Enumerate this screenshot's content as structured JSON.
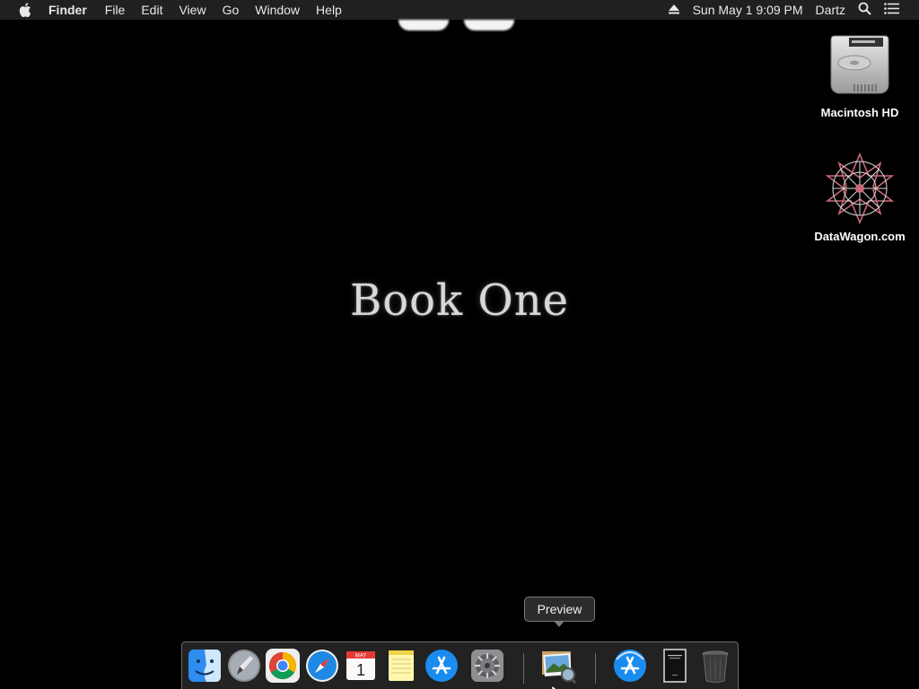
{
  "menubar": {
    "apple_icon": "apple-icon",
    "app_name": "Finder",
    "menus": [
      "File",
      "Edit",
      "View",
      "Go",
      "Window",
      "Help"
    ],
    "eject_icon": "eject-icon",
    "clock": "Sun May 1  9:09 PM",
    "user": "Dartz",
    "search_icon": "spotlight-search-icon",
    "notifications_icon": "notification-center-icon"
  },
  "wallpaper": {
    "title": "Book One"
  },
  "desktop_icons": [
    {
      "label": "Macintosh HD",
      "icon": "hard-drive-icon"
    },
    {
      "label": "DataWagon.com",
      "icon": "datawagon-logo-icon"
    }
  ],
  "dock": {
    "tooltip": "Preview",
    "apps": [
      {
        "name": "Finder",
        "icon": "finder-icon",
        "running": true
      },
      {
        "name": "Launchpad",
        "icon": "launchpad-icon",
        "running": false
      },
      {
        "name": "Google Chrome",
        "icon": "chrome-icon",
        "running": true
      },
      {
        "name": "Safari",
        "icon": "safari-icon",
        "running": true
      },
      {
        "name": "Calendar",
        "icon": "calendar-icon",
        "running": false,
        "month": "MAY",
        "day": "1"
      },
      {
        "name": "Notes",
        "icon": "notes-icon",
        "running": false
      },
      {
        "name": "App Store",
        "icon": "app-store-icon",
        "running": false
      },
      {
        "name": "System Preferences",
        "icon": "system-preferences-icon",
        "running": false
      },
      {
        "name": "Preview",
        "icon": "preview-icon",
        "running": false
      },
      {
        "name": "App Store Downloads",
        "icon": "app-store-icon",
        "running": false
      },
      {
        "name": "Document",
        "icon": "document-icon",
        "running": false
      },
      {
        "name": "Trash",
        "icon": "trash-icon",
        "running": false
      }
    ]
  },
  "colors": {
    "menubar_bg": "#202020",
    "desktop_bg": "#000000",
    "dock_bg": "#282828"
  }
}
